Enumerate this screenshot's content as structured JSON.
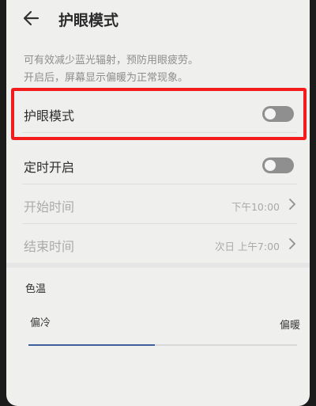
{
  "header": {
    "title": "护眼模式"
  },
  "description": {
    "line1": "可有效减少蓝光辐射，预防用眼疲劳。",
    "line2": "开启后，屏幕显示偏暖为正常现象。"
  },
  "settings": {
    "eye_comfort": {
      "label": "护眼模式",
      "enabled": false
    },
    "scheduled": {
      "label": "定时开启",
      "enabled": false
    },
    "start_time": {
      "label": "开始时间",
      "value": "下午10:00"
    },
    "end_time": {
      "label": "结束时间",
      "value": "次日 上午7:00"
    }
  },
  "color_temp": {
    "title": "色温",
    "cold_label": "偏冷",
    "warm_label": "偏暖",
    "level": 0.47
  },
  "colors": {
    "highlight": "#f31b1b",
    "slider_accent": "#3f5f9c",
    "toggle_off": "#8f8f8f"
  }
}
